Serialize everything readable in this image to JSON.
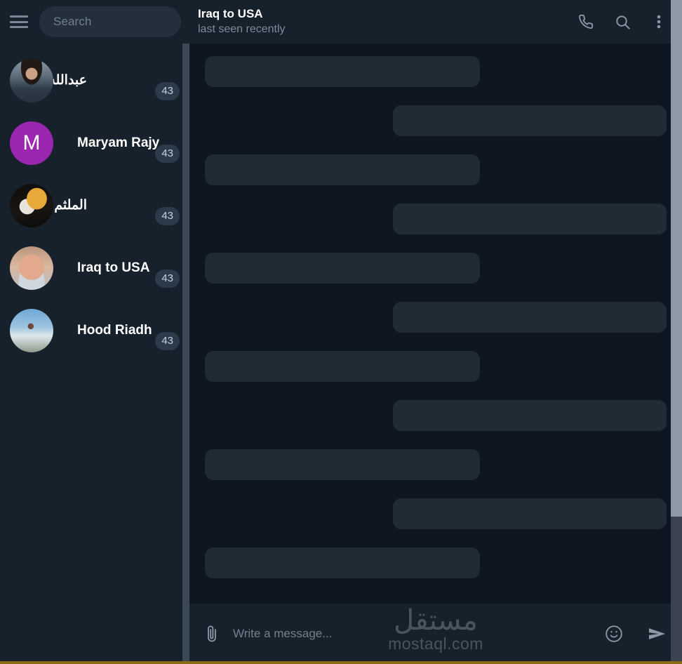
{
  "sidebar": {
    "menu_icon": "hamburger-menu-icon",
    "search": {
      "placeholder": "Search",
      "value": "",
      "icon": "search-icon"
    },
    "chats": [
      {
        "name": "عبدالله فاضل",
        "rtl": true,
        "badge": "43",
        "avatar_type": "photo",
        "avatar_class": "av-photo1",
        "initial": ""
      },
      {
        "name": "Maryam Rajy",
        "rtl": false,
        "badge": "43",
        "avatar_type": "initial",
        "avatar_class": "av-initial-purple",
        "initial": "M"
      },
      {
        "name": "الملثم",
        "rtl": true,
        "badge": "43",
        "avatar_type": "photo",
        "avatar_class": "av-photo2",
        "initial": ""
      },
      {
        "name": "Iraq to USA",
        "rtl": false,
        "badge": "43",
        "avatar_type": "photo",
        "avatar_class": "av-photo3",
        "initial": ""
      },
      {
        "name": "Hood Riadh",
        "rtl": false,
        "badge": "43",
        "avatar_type": "photo",
        "avatar_class": "av-photo4",
        "initial": ""
      }
    ]
  },
  "chat": {
    "title": "Iraq to USA",
    "subtitle": "last seen recently",
    "actions": [
      {
        "name": "call-icon",
        "label": "Call"
      },
      {
        "name": "search-icon",
        "label": "Search"
      },
      {
        "name": "more-options-icon",
        "label": "More"
      }
    ],
    "messages": [
      {
        "direction": "in",
        "text": ""
      },
      {
        "direction": "out",
        "text": ""
      },
      {
        "direction": "in",
        "text": ""
      },
      {
        "direction": "out",
        "text": ""
      },
      {
        "direction": "in",
        "text": ""
      },
      {
        "direction": "out",
        "text": ""
      },
      {
        "direction": "in",
        "text": ""
      },
      {
        "direction": "out",
        "text": ""
      },
      {
        "direction": "in",
        "text": ""
      },
      {
        "direction": "out",
        "text": ""
      },
      {
        "direction": "in",
        "text": ""
      }
    ]
  },
  "composer": {
    "attach_icon": "paperclip-icon",
    "placeholder": "Write a message...",
    "value": "",
    "emoji_icon": "emoji-smile-icon",
    "send_icon": "send-icon"
  },
  "watermark": {
    "arabic": "مستقل",
    "latin": "mostaql.com"
  },
  "colors": {
    "sidebar_bg": "#17212b",
    "chat_bg": "#0e1621",
    "bubble": "#212b36",
    "search_bg": "#242f3d",
    "badge_bg": "#2d3a4b",
    "accent_purple": "#9b27b0",
    "bottom_line": "#8a6a15",
    "scrollbar_thumb": "#8e99a8"
  }
}
